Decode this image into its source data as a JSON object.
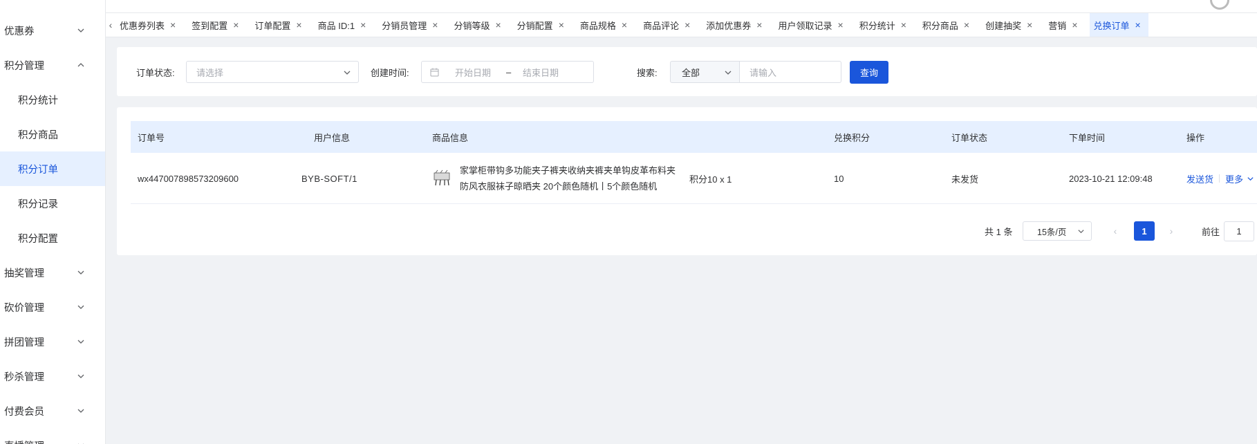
{
  "sidebar": {
    "items": [
      {
        "label": "优惠券",
        "expanded": false
      },
      {
        "label": "积分管理",
        "expanded": true
      },
      {
        "label": "抽奖管理",
        "expanded": false
      },
      {
        "label": "砍价管理",
        "expanded": false
      },
      {
        "label": "拼团管理",
        "expanded": false
      },
      {
        "label": "秒杀管理",
        "expanded": false
      },
      {
        "label": "付费会员",
        "expanded": false
      },
      {
        "label": "直播管理",
        "expanded": false
      }
    ],
    "submenu": [
      {
        "label": "积分统计"
      },
      {
        "label": "积分商品"
      },
      {
        "label": "积分订单",
        "active": true
      },
      {
        "label": "积分记录"
      },
      {
        "label": "积分配置"
      }
    ]
  },
  "tabs": [
    {
      "label": "优惠券列表"
    },
    {
      "label": "签到配置"
    },
    {
      "label": "订单配置"
    },
    {
      "label": "商品 ID:1"
    },
    {
      "label": "分销员管理"
    },
    {
      "label": "分销等级"
    },
    {
      "label": "分销配置"
    },
    {
      "label": "商品规格"
    },
    {
      "label": "商品评论"
    },
    {
      "label": "添加优惠券"
    },
    {
      "label": "用户领取记录"
    },
    {
      "label": "积分统计"
    },
    {
      "label": "积分商品"
    },
    {
      "label": "创建抽奖"
    },
    {
      "label": "营销"
    },
    {
      "label": "兑换订单",
      "active": true
    }
  ],
  "filter": {
    "status_label": "订单状态:",
    "status_placeholder": "请选择",
    "created_label": "创建时间:",
    "start_placeholder": "开始日期",
    "range_sep": "–",
    "end_placeholder": "结束日期",
    "search_label": "搜索:",
    "search_scope": "全部",
    "search_placeholder": "请输入",
    "query_button": "查询"
  },
  "table": {
    "headers": {
      "order_no": "订单号",
      "user": "用户信息",
      "goods": "商品信息",
      "points": "兑换积分",
      "status": "订单状态",
      "time": "下单时间",
      "actions": "操作"
    },
    "rows": [
      {
        "order_no": "wx447007898573209600",
        "user": "BYB-SOFT/1",
        "goods_name": "家掌柜带钩多功能夹子裤夹收纳夹裤夹单钩皮革布料夹防风衣服袜子晾晒夹 20个颜色随机丨5个颜色随机",
        "goods_spec": "积分10 x 1",
        "points": "10",
        "status": "未发货",
        "time": "2023-10-21 12:09:48",
        "action_ship": "发送货",
        "action_more": "更多"
      }
    ]
  },
  "pagination": {
    "total": "共 1 条",
    "page_size": "15条/页",
    "current_page": "1",
    "goto_label": "前往",
    "goto_value": "1"
  }
}
